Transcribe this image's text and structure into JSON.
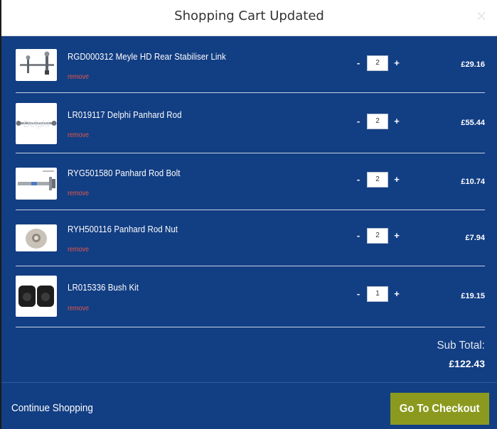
{
  "modal": {
    "title": "Shopping Cart Updated",
    "close_symbol": "×"
  },
  "cart": {
    "items": [
      {
        "name": "RGD000312 Meyle HD Rear Stabiliser Link",
        "remove_label": "remove",
        "minus_label": "-",
        "plus_label": "+",
        "quantity": "2",
        "price": "£29.16",
        "thumbnail_icon": "stabiliser-link-icon"
      },
      {
        "name": "LR019117 Delphi Panhard Rod",
        "remove_label": "remove",
        "minus_label": "-",
        "plus_label": "+",
        "quantity": "2",
        "price": "£55.44",
        "thumbnail_icon": "panhard-rod-icon"
      },
      {
        "name": "RYG501580 Panhard Rod Bolt",
        "remove_label": "remove",
        "minus_label": "-",
        "plus_label": "+",
        "quantity": "2",
        "price": "£10.74",
        "thumbnail_icon": "bolt-icon"
      },
      {
        "name": "RYH500116 Panhard Rod Nut",
        "remove_label": "remove",
        "minus_label": "-",
        "plus_label": "+",
        "quantity": "2",
        "price": "£7.94",
        "thumbnail_icon": "nut-icon"
      },
      {
        "name": "LR015336 Bush Kit",
        "remove_label": "remove",
        "minus_label": "-",
        "plus_label": "+",
        "quantity": "1",
        "price": "£19.15",
        "thumbnail_icon": "bush-kit-icon"
      }
    ]
  },
  "summary": {
    "subtotal_label": "Sub Total:",
    "subtotal_value": "£122.43"
  },
  "footer": {
    "continue_label": "Continue Shopping",
    "checkout_label": "Go To Checkout"
  },
  "colors": {
    "modal_background": "#123e83",
    "checkout_button": "#8b9a1f",
    "remove_link": "#e3574b"
  }
}
